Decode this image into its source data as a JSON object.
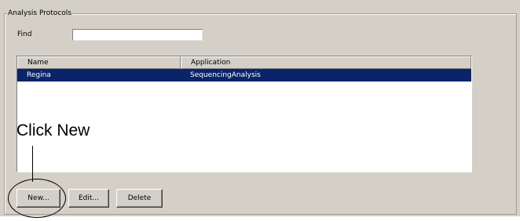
{
  "group": {
    "title": "Analysis Protocols"
  },
  "find": {
    "label": "Find",
    "value": ""
  },
  "table": {
    "columns": [
      "Name",
      "Application"
    ],
    "rows": [
      {
        "name": "Regina",
        "application": "SequencingAnalysis",
        "selected": true
      }
    ]
  },
  "buttons": {
    "new_label": "New...",
    "edit_label": "Edit...",
    "delete_label": "Delete"
  },
  "annotation": {
    "callout_text": "Click New"
  },
  "colors": {
    "panel_background": "#d4d0c8",
    "selection_background": "#0a246a",
    "selection_text": "#ffffff"
  }
}
